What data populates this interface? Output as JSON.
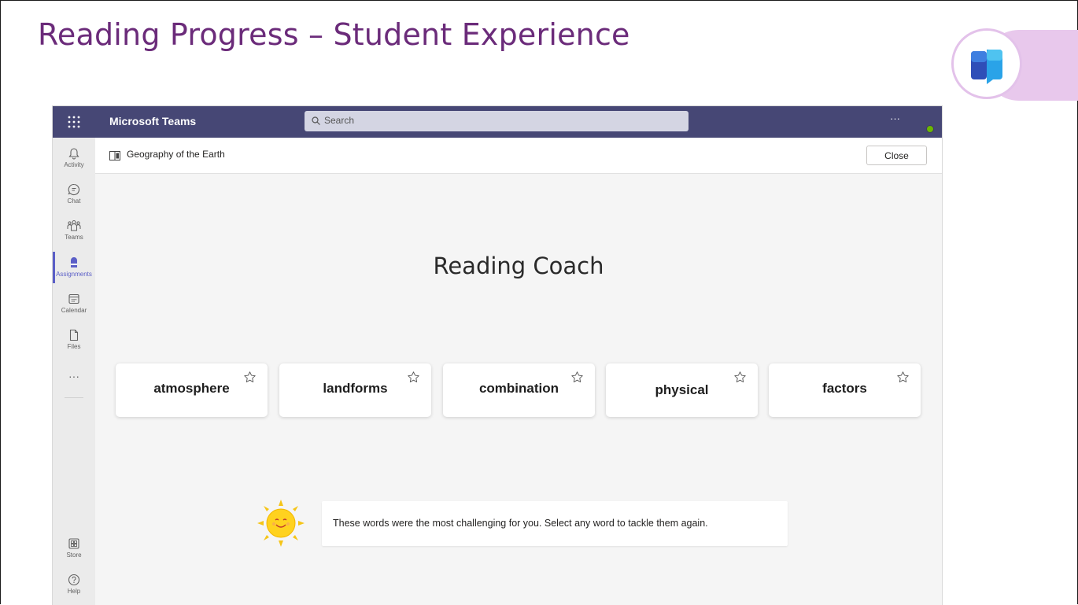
{
  "slide": {
    "title": "Reading Progress – Student Experience"
  },
  "teams": {
    "app_name": "Microsoft Teams",
    "search_placeholder": "Search",
    "more_label": "···",
    "rail": [
      {
        "label": "Activity",
        "icon": "bell-icon"
      },
      {
        "label": "Chat",
        "icon": "chat-icon"
      },
      {
        "label": "Teams",
        "icon": "teams-icon"
      },
      {
        "label": "Assignments",
        "icon": "backpack-icon",
        "active": true
      },
      {
        "label": "Calendar",
        "icon": "calendar-icon"
      },
      {
        "label": "Files",
        "icon": "file-icon"
      }
    ],
    "rail_more": "···",
    "rail_bottom": [
      {
        "label": "Store",
        "icon": "store-icon"
      },
      {
        "label": "Help",
        "icon": "help-icon"
      }
    ],
    "document_title": "Geography of the Earth",
    "close_label": "Close"
  },
  "coach": {
    "title": "Reading Coach",
    "words": [
      "atmosphere",
      "landforms",
      "combination",
      "physical",
      "factors"
    ],
    "message": "These words were the most challenging for you. Select any word to tackle them again."
  },
  "colors": {
    "title_purple": "#6b2b7a",
    "teams_bar": "#464775",
    "accent": "#5b5fc7"
  }
}
